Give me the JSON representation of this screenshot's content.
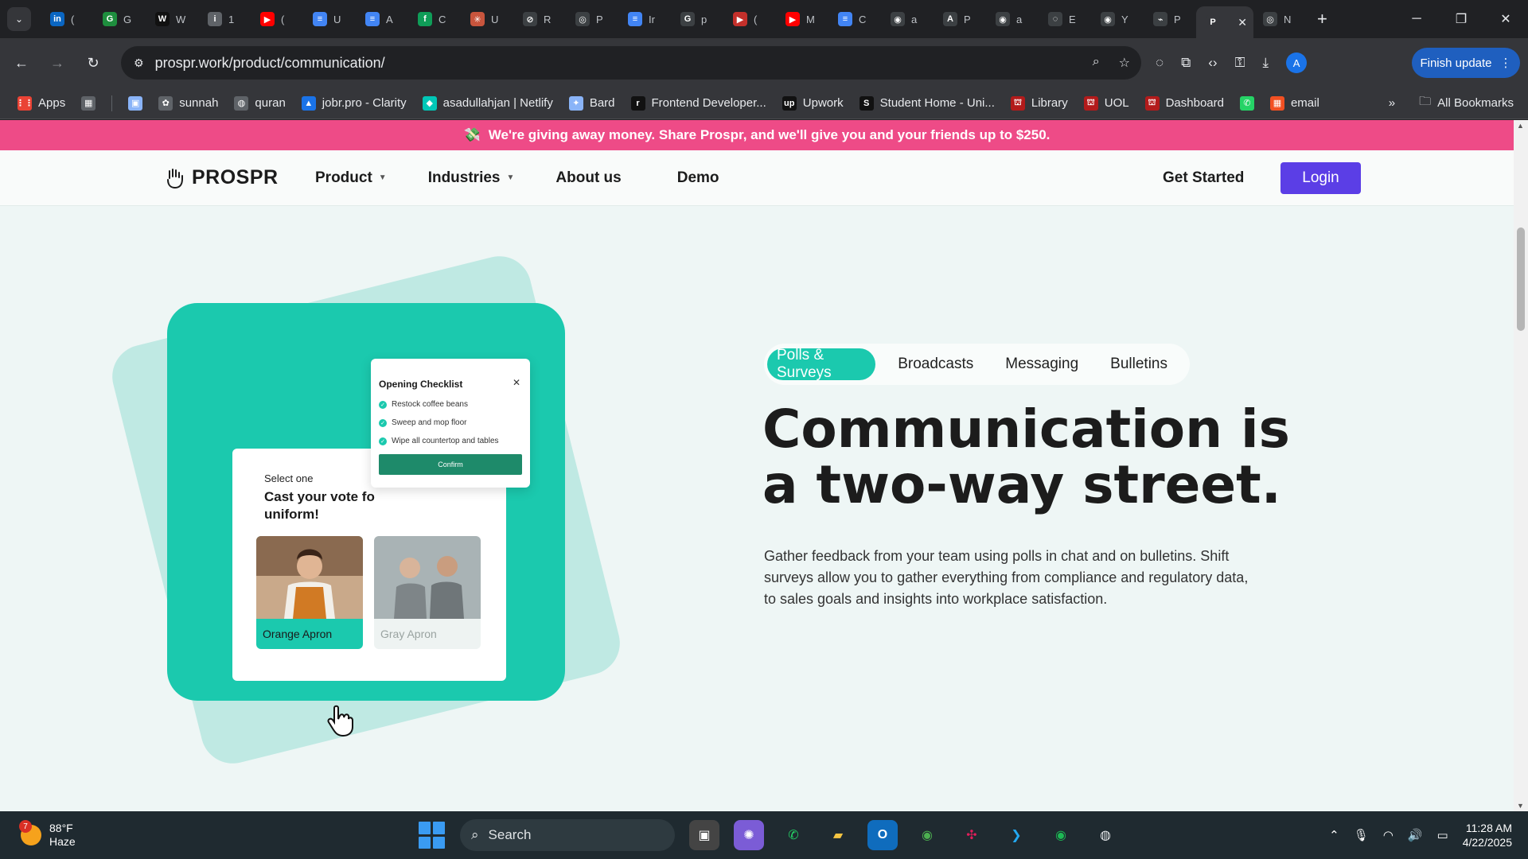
{
  "browser": {
    "tabs": [
      {
        "icon": "linkedin-icon",
        "color": "#0a66c2",
        "glyph": "in",
        "title": "("
      },
      {
        "icon": "green-square-icon",
        "color": "#1e8e3e",
        "glyph": "G",
        "title": "G"
      },
      {
        "icon": "nike-icon",
        "color": "#111111",
        "glyph": "W",
        "title": "W"
      },
      {
        "icon": "info-icon",
        "color": "#5f6368",
        "glyph": "i",
        "title": "1"
      },
      {
        "icon": "youtube-icon",
        "color": "#ff0000",
        "glyph": "▶",
        "title": "("
      },
      {
        "icon": "docs-icon",
        "color": "#4285f4",
        "glyph": "≡",
        "title": "U"
      },
      {
        "icon": "docs-icon",
        "color": "#4285f4",
        "glyph": "≡",
        "title": "A"
      },
      {
        "icon": "green-circle-icon",
        "color": "#0f9d58",
        "glyph": "f",
        "title": "C"
      },
      {
        "icon": "asterisk-icon",
        "color": "#c8553d",
        "glyph": "✳",
        "title": "U"
      },
      {
        "icon": "slash-icon",
        "color": "#3c4043",
        "glyph": "⊘",
        "title": "R"
      },
      {
        "icon": "openai-icon",
        "color": "#3c4043",
        "glyph": "◎",
        "title": "P"
      },
      {
        "icon": "docs-icon",
        "color": "#4285f4",
        "glyph": "≡",
        "title": "Ir"
      },
      {
        "icon": "google-icon",
        "color": "#3c4043",
        "glyph": "G",
        "title": "p"
      },
      {
        "icon": "youtube-icon",
        "color": "#c4302b",
        "glyph": "▶",
        "title": "("
      },
      {
        "icon": "youtube-icon",
        "color": "#ff0000",
        "glyph": "▶",
        "title": "M"
      },
      {
        "icon": "docs-icon",
        "color": "#4285f4",
        "glyph": "≡",
        "title": "C"
      },
      {
        "icon": "github-icon",
        "color": "#3c4043",
        "glyph": "◉",
        "title": "a"
      },
      {
        "icon": "a-icon",
        "color": "#3c4043",
        "glyph": "A",
        "title": "P"
      },
      {
        "icon": "github-icon",
        "color": "#3c4043",
        "glyph": "◉",
        "title": "a"
      },
      {
        "icon": "dashed-circle-icon",
        "color": "#3c4043",
        "glyph": "◌",
        "title": "E"
      },
      {
        "icon": "github-icon",
        "color": "#3c4043",
        "glyph": "◉",
        "title": "Y"
      },
      {
        "icon": "prospr-icon",
        "color": "#3c4043",
        "glyph": "⌁",
        "title": "P"
      },
      {
        "icon": "p-icon",
        "color": "#35363a",
        "glyph": "P",
        "title": "",
        "active": true
      },
      {
        "icon": "openai-icon",
        "color": "#3c4043",
        "glyph": "◎",
        "title": "N"
      }
    ],
    "url": "prospr.work/product/communication/",
    "finish_update": "Finish update",
    "profile_initial": "A",
    "bookmarks": [
      {
        "icon": "apps-icon",
        "color": "#ea4335",
        "glyph": "⋮⋮",
        "label": "Apps"
      },
      {
        "icon": "grid-icon",
        "color": "#5f6368",
        "glyph": "▦",
        "label": ""
      },
      {
        "icon": "bookmark-icon",
        "color": "#8ab4f8",
        "glyph": "▣",
        "label": ""
      },
      {
        "icon": "sunnah-icon",
        "color": "#5f6368",
        "glyph": "✿",
        "label": "sunnah"
      },
      {
        "icon": "globe-icon",
        "color": "#5f6368",
        "glyph": "◍",
        "label": "quran"
      },
      {
        "icon": "clarity-icon",
        "color": "#1a73e8",
        "glyph": "▲",
        "label": "jobr.pro - Clarity"
      },
      {
        "icon": "netlify-icon",
        "color": "#00c7b7",
        "glyph": "◆",
        "label": "asadullahjan | Netlify"
      },
      {
        "icon": "bard-icon",
        "color": "#8ab4f8",
        "glyph": "✦",
        "label": "Bard"
      },
      {
        "icon": "frontend-icon",
        "color": "#111111",
        "glyph": "r",
        "label": "Frontend Developer..."
      },
      {
        "icon": "upwork-icon",
        "color": "#111111",
        "glyph": "up",
        "label": "Upwork"
      },
      {
        "icon": "s-icon",
        "color": "#111111",
        "glyph": "S",
        "label": "Student Home - Uni..."
      },
      {
        "icon": "library-icon",
        "color": "#b31b1b",
        "glyph": "⛫",
        "label": "Library"
      },
      {
        "icon": "uol-icon",
        "color": "#b31b1b",
        "glyph": "⛫",
        "label": "UOL"
      },
      {
        "icon": "dashboard-icon",
        "color": "#b31b1b",
        "glyph": "⛫",
        "label": "Dashboard"
      },
      {
        "icon": "whatsapp-icon",
        "color": "#25d366",
        "glyph": "✆",
        "label": ""
      },
      {
        "icon": "microsoft-icon",
        "color": "#f25022",
        "glyph": "▦",
        "label": "email"
      }
    ],
    "all_bookmarks": "All Bookmarks"
  },
  "page": {
    "promo": "We're giving away money. Share Prospr, and we'll give you and your friends up to $250.",
    "logo_text": "PROSPR",
    "nav": {
      "product": "Product",
      "industries": "Industries",
      "about": "About us",
      "demo": "Demo",
      "get_started": "Get Started",
      "login": "Login"
    },
    "art": {
      "select_one": "Select one",
      "question": "Cast your vote fo uniform!",
      "option1": "Orange Apron",
      "option2": "Gray Apron",
      "checklist_title": "Opening Checklist",
      "checklist_items": [
        "Restock coffee beans",
        "Sweep and mop floor",
        "Wipe all countertop and tables"
      ],
      "confirm": "Confirm"
    },
    "feature_tabs": [
      "Polls & Surveys",
      "Broadcasts",
      "Messaging",
      "Bulletins"
    ],
    "active_tab": "Polls & Surveys",
    "headline": "Communication is a two-way street.",
    "description": "Gather feedback from your team using polls in chat and on bulletins. Shift surveys allow you to gather everything from compliance and regulatory data, to sales goals and insights into workplace satisfaction."
  },
  "taskbar": {
    "weather_badge": "7",
    "temperature": "88°F",
    "condition": "Haze",
    "search": "Search",
    "time": "11:28 AM",
    "date": "4/22/2025"
  }
}
